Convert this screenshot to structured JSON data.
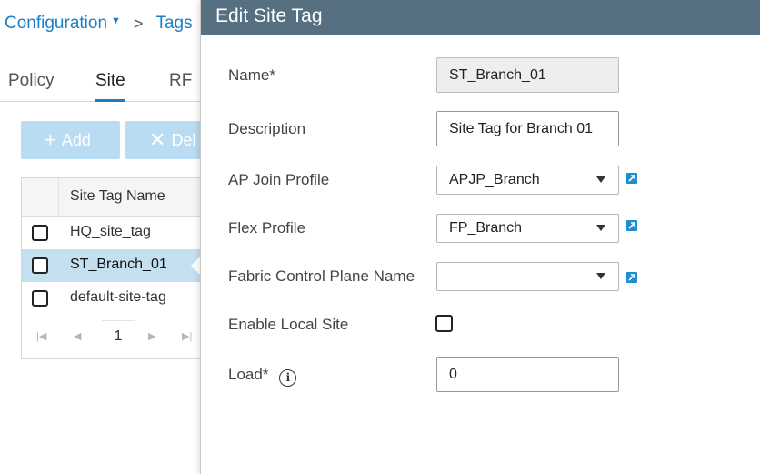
{
  "breadcrumb": {
    "root": "Configuration",
    "separator": ">",
    "current": "Tags"
  },
  "tabs": [
    {
      "label": "Policy"
    },
    {
      "label": "Site"
    },
    {
      "label": "RF"
    }
  ],
  "toolbar": {
    "add_label": "Add",
    "delete_label": "Del"
  },
  "table": {
    "column_header": "Site Tag Name",
    "rows": [
      {
        "name": "HQ_site_tag"
      },
      {
        "name": "ST_Branch_01"
      },
      {
        "name": "default-site-tag"
      }
    ],
    "current_page": "1"
  },
  "drawer": {
    "title": "Edit Site Tag",
    "fields": {
      "name_label": "Name*",
      "name_value": "ST_Branch_01",
      "description_label": "Description",
      "description_value": "Site Tag for Branch 01",
      "ap_join_label": "AP Join Profile",
      "ap_join_value": "APJP_Branch",
      "flex_label": "Flex Profile",
      "flex_value": "FP_Branch",
      "fabric_label": "Fabric Control Plane Name",
      "fabric_value": "",
      "local_site_label": "Enable Local Site",
      "load_label": "Load*",
      "load_value": "0"
    }
  },
  "icons": {
    "info": "info-icon",
    "external": "external-link-icon",
    "dropdown": "chevron-down-icon"
  },
  "colors": {
    "link_blue": "#1b7fc5",
    "header_bg": "#566f81",
    "selected_row": "#c3dff0",
    "disabled_button": "#b9dcf2",
    "edit_icon": "#1b8fd0"
  }
}
